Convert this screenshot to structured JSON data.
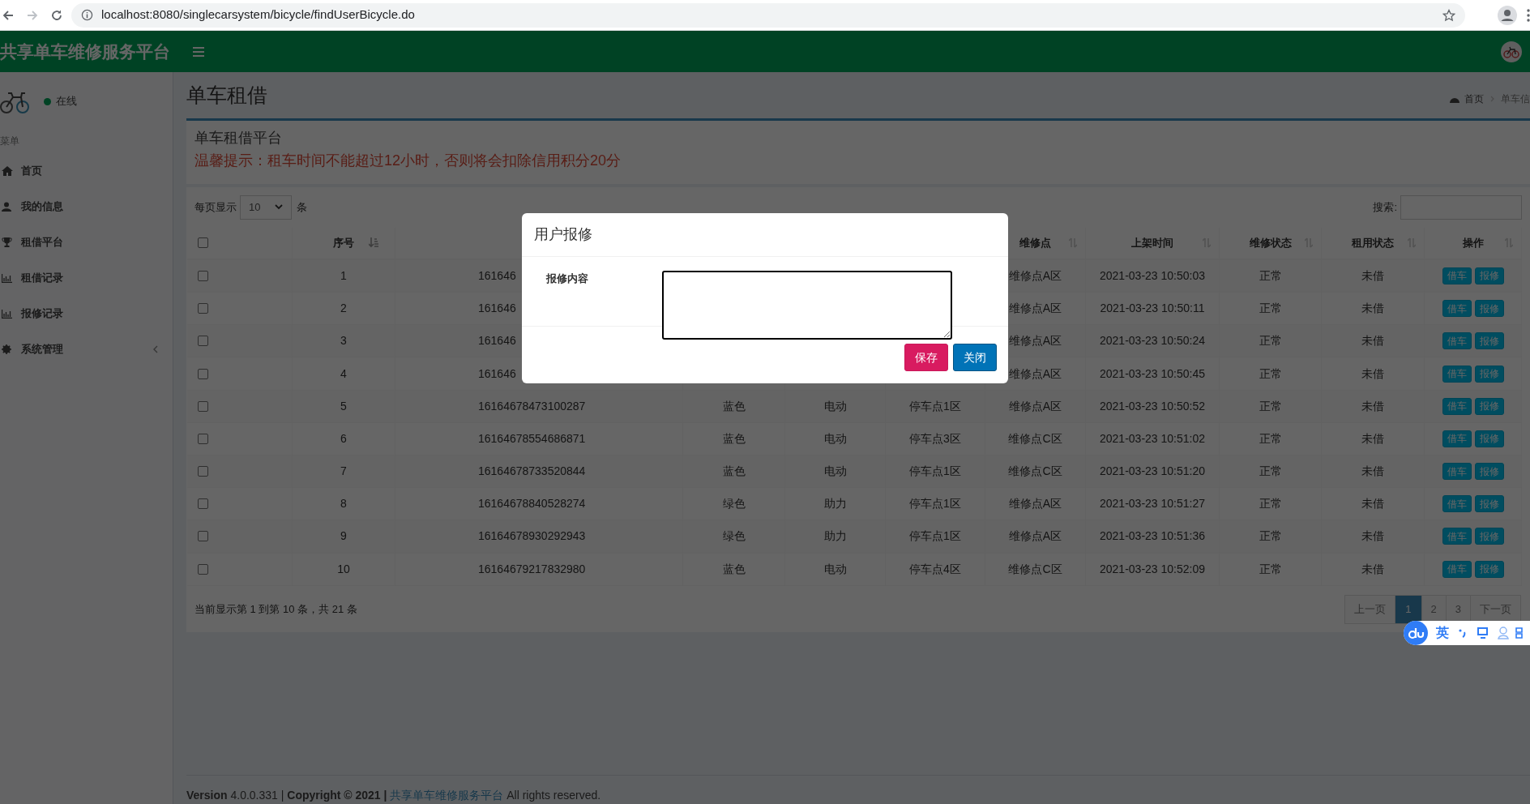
{
  "browser": {
    "url": "localhost:8080/singlecarsystem/bicycle/findUserBicycle.do"
  },
  "header": {
    "brand": "共享单车维修服务平台"
  },
  "sidebar": {
    "status": "在线",
    "section": "菜单",
    "items": [
      {
        "label": "首页",
        "kind": "link"
      },
      {
        "label": "我的信息",
        "kind": "link"
      },
      {
        "label": "租借平台",
        "kind": "link"
      },
      {
        "label": "租借记录",
        "kind": "link"
      },
      {
        "label": "报修记录",
        "kind": "link"
      },
      {
        "label": "系统管理",
        "kind": "tree"
      }
    ]
  },
  "page": {
    "title": "单车租借",
    "breadcrumb": [
      "首页",
      "单车信"
    ]
  },
  "notice_box": {
    "title": "单车租借平台",
    "warning": "温馨提示：租车时间不能超过12小时，否则将会扣除信用积分20分"
  },
  "table_controls": {
    "length_prefix": "每页显示",
    "length_value": "10",
    "length_suffix": "条",
    "search_label": "搜索:"
  },
  "table": {
    "select_all_checked": false,
    "columns": [
      {
        "label": "序号",
        "sorted": true
      },
      {
        "label": "维修点",
        "sorted": false
      },
      {
        "label": "上架时间",
        "sorted": false
      },
      {
        "label": "维修状态",
        "sorted": false
      },
      {
        "label": "租用状态",
        "sorted": false
      },
      {
        "label": "操作",
        "sorted": false
      }
    ],
    "rows": [
      {
        "checked": false,
        "index": "1",
        "number": "161646",
        "repair_point": "维修点A区",
        "time": "2021-03-23 10:50:03",
        "repair_status": "正常",
        "rent_status": "未借",
        "actions": [
          "借车",
          "报修"
        ]
      },
      {
        "checked": false,
        "index": "2",
        "number": "161646",
        "repair_point": "维修点A区",
        "time": "2021-03-23 10:50:11",
        "repair_status": "正常",
        "rent_status": "未借",
        "actions": [
          "借车",
          "报修"
        ]
      },
      {
        "checked": false,
        "index": "3",
        "number": "161646",
        "repair_point": "维修点A区",
        "time": "2021-03-23 10:50:24",
        "repair_status": "正常",
        "rent_status": "未借",
        "actions": [
          "借车",
          "报修"
        ]
      },
      {
        "checked": false,
        "index": "4",
        "number": "161646",
        "repair_point": "维修点A区",
        "time": "2021-03-23 10:50:45",
        "repair_status": "正常",
        "rent_status": "未借",
        "actions": [
          "借车",
          "报修"
        ]
      },
      {
        "checked": false,
        "index": "5",
        "number": "16164678473100287",
        "bike_color": "蓝色",
        "type": "电动",
        "parking": "停车点1区",
        "repair_point": "维修点A区",
        "time": "2021-03-23 10:50:52",
        "repair_status": "正常",
        "rent_status": "未借",
        "actions": [
          "借车",
          "报修"
        ]
      },
      {
        "checked": false,
        "index": "6",
        "number": "16164678554686871",
        "bike_color": "蓝色",
        "type": "电动",
        "parking": "停车点3区",
        "repair_point": "维修点C区",
        "time": "2021-03-23 10:51:02",
        "repair_status": "正常",
        "rent_status": "未借",
        "actions": [
          "借车",
          "报修"
        ]
      },
      {
        "checked": false,
        "index": "7",
        "number": "16164678733520844",
        "bike_color": "蓝色",
        "type": "电动",
        "parking": "停车点1区",
        "repair_point": "维修点C区",
        "time": "2021-03-23 10:51:20",
        "repair_status": "正常",
        "rent_status": "未借",
        "actions": [
          "借车",
          "报修"
        ]
      },
      {
        "checked": false,
        "index": "8",
        "number": "16164678840528274",
        "bike_color": "绿色",
        "type": "助力",
        "parking": "停车点1区",
        "repair_point": "维修点A区",
        "time": "2021-03-23 10:51:27",
        "repair_status": "正常",
        "rent_status": "未借",
        "actions": [
          "借车",
          "报修"
        ]
      },
      {
        "checked": false,
        "index": "9",
        "number": "16164678930292943",
        "bike_color": "绿色",
        "type": "助力",
        "parking": "停车点1区",
        "repair_point": "维修点A区",
        "time": "2021-03-23 10:51:36",
        "repair_status": "正常",
        "rent_status": "未借",
        "actions": [
          "借车",
          "报修"
        ]
      },
      {
        "checked": false,
        "index": "10",
        "number": "16164679217832980",
        "bike_color": "蓝色",
        "type": "电动",
        "parking": "停车点4区",
        "repair_point": "维修点C区",
        "time": "2021-03-23 10:52:09",
        "repair_status": "正常",
        "rent_status": "未借",
        "actions": [
          "借车",
          "报修"
        ]
      }
    ]
  },
  "table_info": "当前显示第 1 到第 10 条，共 21 条",
  "pagination": [
    {
      "label": "上一页",
      "selected": false
    },
    {
      "label": "1",
      "selected": true
    },
    {
      "label": "2",
      "selected": false
    },
    {
      "label": "3",
      "selected": false
    },
    {
      "label": "下一页",
      "selected": false
    }
  ],
  "footer": {
    "before": "**Version** 4.0.0.331 | **Copyright © 2021 |**",
    "link": "共享单车维修服务平台",
    "after": "All rights reserved."
  },
  "modal": {
    "title": "用户报修",
    "field_label": "报修内容",
    "buttons": [
      {
        "label": "保存",
        "kind": "danger"
      },
      {
        "label": "关闭",
        "kind": "primary"
      }
    ]
  },
  "ime": {
    "mode": "英"
  }
}
